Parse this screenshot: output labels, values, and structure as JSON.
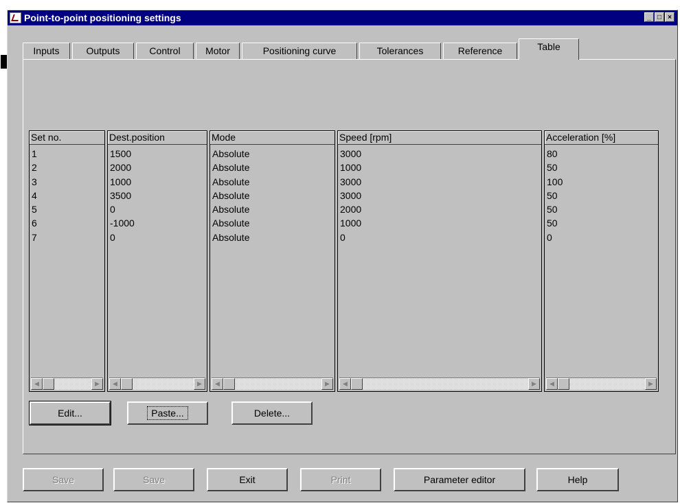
{
  "window": {
    "title": "Point-to-point positioning settings"
  },
  "tabs": [
    {
      "label": "Inputs"
    },
    {
      "label": "Outputs"
    },
    {
      "label": "Control"
    },
    {
      "label": "Motor"
    },
    {
      "label": "Positioning curve"
    },
    {
      "label": "Tolerances"
    },
    {
      "label": "Reference"
    },
    {
      "label": "Table"
    }
  ],
  "active_tab": "Table",
  "table": {
    "columns": [
      {
        "header": "Set no.",
        "values": [
          "1",
          "2",
          "3",
          "4",
          "5",
          "6",
          "7"
        ]
      },
      {
        "header": "Dest.position",
        "values": [
          "1500",
          "2000",
          "1000",
          "3500",
          "0",
          "-1000",
          "0"
        ]
      },
      {
        "header": "Mode",
        "values": [
          "Absolute",
          "Absolute",
          "Absolute",
          "Absolute",
          "Absolute",
          "Absolute",
          "Absolute"
        ]
      },
      {
        "header": "Speed [rpm]",
        "values": [
          "3000",
          "1000",
          "3000",
          "3000",
          "2000",
          "1000",
          "0"
        ]
      },
      {
        "header": "Acceleration [%]",
        "values": [
          "80",
          "50",
          "100",
          "50",
          "50",
          "50",
          "0"
        ]
      }
    ]
  },
  "panel_buttons": {
    "edit": "Edit...",
    "paste": "Paste...",
    "delete": "Delete..."
  },
  "bottom_buttons": {
    "save1": {
      "label": "Save",
      "disabled": true
    },
    "save2": {
      "label": "Save",
      "disabled": true
    },
    "exit": {
      "label": "Exit",
      "disabled": false
    },
    "print": {
      "label": "Print",
      "disabled": true
    },
    "param": {
      "label": "Parameter editor",
      "disabled": false
    },
    "help": {
      "label": "Help",
      "disabled": false
    }
  }
}
